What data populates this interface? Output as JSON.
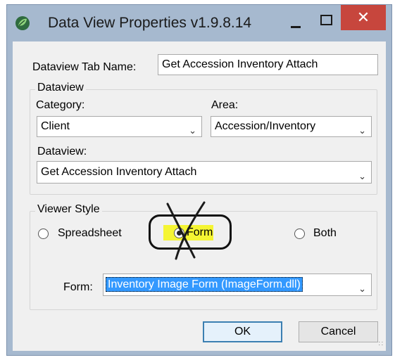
{
  "window": {
    "title": "Data View Properties v1.9.8.14",
    "close_glyph": "✕",
    "icon": "app-leaf-icon"
  },
  "tab_name": {
    "label": "Dataview Tab Name:",
    "value": "Get Accession Inventory Attach"
  },
  "dataview_group": {
    "legend": "Dataview",
    "category_label": "Category:",
    "category_value": "Client",
    "area_label": "Area:",
    "area_value": "Accession/Inventory",
    "dataview_label": "Dataview:",
    "dataview_value": "Get Accession Inventory Attach"
  },
  "viewer_style": {
    "legend": "Viewer Style",
    "options": [
      "Spreadsheet",
      "Form",
      "Both"
    ],
    "selected": "Form",
    "form_label": "Form:",
    "form_value": "Inventory Image Form   (ImageForm.dll)"
  },
  "buttons": {
    "ok": "OK",
    "cancel": "Cancel"
  },
  "colors": {
    "close_button": "#c7463d",
    "highlight": "#f5f533",
    "selection": "#3399ff"
  }
}
